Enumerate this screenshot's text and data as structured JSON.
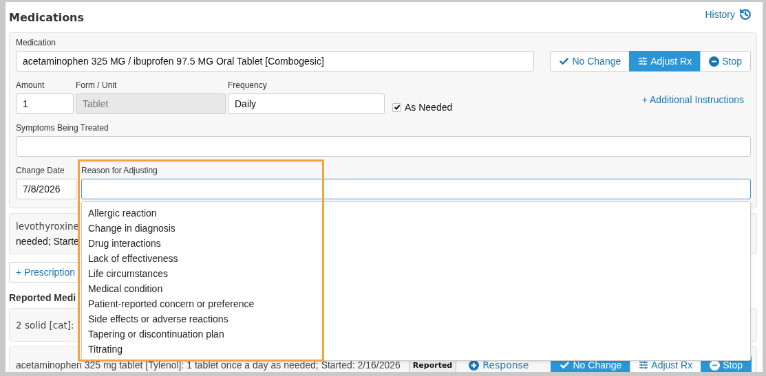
{
  "header": {
    "title": "Medications",
    "history_link": "History"
  },
  "form": {
    "medication": {
      "label": "Medication",
      "value": "acetaminophen 325 MG / ibuprofen 97.5 MG Oral Tablet [Combogesic]"
    },
    "actions": [
      {
        "kind": "check",
        "label": "No Change",
        "selected": false
      },
      {
        "kind": "sliders",
        "label": "Adjust Rx",
        "selected": true
      },
      {
        "kind": "stop",
        "label": "Stop",
        "selected": false
      }
    ],
    "amount": {
      "label": "Amount",
      "value": "1"
    },
    "form_unit": {
      "label": "Form / Unit",
      "value": "Tablet",
      "disabled": true
    },
    "frequency": {
      "label": "Frequency",
      "value": "Daily"
    },
    "as_needed": {
      "label": "As Needed",
      "checked": true
    },
    "additional_link": "+ Additional Instructions",
    "symptoms": {
      "label": "Symptoms Being Treated"
    },
    "change_date": {
      "label": "Change Date",
      "value": "7/8/2026"
    },
    "reason": {
      "label": "Reason for Adjusting",
      "focused": true,
      "expanded": true,
      "options": [
        "Allergic reaction",
        "Change in diagnosis",
        "Drug interactions",
        "Lack of effectiveness",
        "Life circumstances",
        "Medical condition",
        "Patient-reported concern or preference",
        "Side effects or adverse reactions",
        "Tapering or discontinuation plan",
        "Titrating"
      ]
    }
  },
  "prescription_card": {
    "lines": [
      "levothyroxine",
      "needed; Starte"
    ]
  },
  "add_prescription": "+ Prescription",
  "reported_heading": "Reported Medi",
  "reported": [
    {
      "text": "2 solid [cat]:"
    },
    {
      "text": "acetaminophen 325 mg tablet [Tylenol]: 1 tablet once a day as needed; Started: 2/16/2026",
      "badge": "Reported",
      "response": "Response",
      "actions": [
        {
          "kind": "check",
          "label": "No Change",
          "selected": true
        },
        {
          "kind": "sliders",
          "label": "Adjust Rx",
          "selected": false
        },
        {
          "kind": "stop",
          "label": "Stop",
          "selected": true
        }
      ]
    }
  ]
}
